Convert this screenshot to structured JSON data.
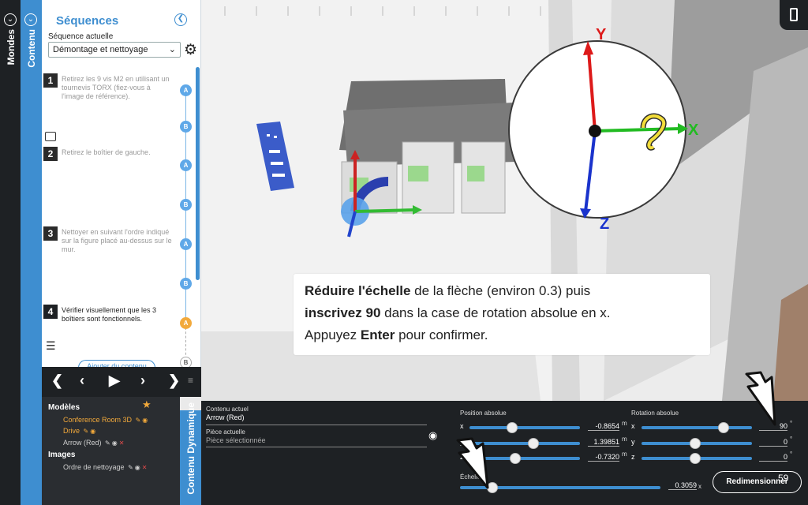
{
  "rail": {
    "mondes_label": "Mondes",
    "contenu_label": "Contenu"
  },
  "sequences": {
    "title": "Séquences",
    "current_label": "Séquence actuelle",
    "selected": "Démontage et nettoyage",
    "steps": [
      {
        "num": "1",
        "text": "Retirez les 9 vis M2 en utilisant un tournevis TORX (fiez-vous à l'image de référence).",
        "nodes": [
          "A",
          "B"
        ]
      },
      {
        "num": "2",
        "text": "Retirez le boîtier de gauche.",
        "nodes": [
          "A",
          "B"
        ]
      },
      {
        "num": "3",
        "text": "Nettoyer en suivant l'ordre indiqué sur la figure placé au-dessus sur le mur.",
        "nodes": [
          "A",
          "B"
        ]
      },
      {
        "num": "4",
        "text": "Vérifier visuellement que les 3 boîtiers sont fonctionnels.",
        "nodes": [
          "A",
          "B"
        ]
      }
    ],
    "add_button": "Ajouter du contenu"
  },
  "models": {
    "models_header": "Modèles",
    "items": [
      {
        "name": "Conference Room 3D",
        "highlight": true
      },
      {
        "name": "Drive",
        "highlight": true
      },
      {
        "name": "Arrow (Red)",
        "highlight": false
      }
    ],
    "images_header": "Images",
    "images": [
      {
        "name": "Ordre de nettoyage"
      }
    ],
    "dynamic_tab": "Contenu Dynamique"
  },
  "props": {
    "current_content_label": "Contenu actuel",
    "current_content": "Arrow (Red)",
    "current_part_label": "Pièce actuelle",
    "current_part_placeholder": "Pièce sélectionnée",
    "position_label": "Position absolue",
    "position": {
      "x": "-0.8654",
      "y": "1.39851",
      "z": "-0.7320",
      "unit": "m"
    },
    "rotation_label": "Rotation absolue",
    "rotation": {
      "x": "90",
      "y": "0",
      "z": "0",
      "unit": "°"
    },
    "scale_label": "Échelle",
    "scale": "0.3059",
    "scale_unit": "x",
    "resize_button": "Redimensionner",
    "fps": "59"
  },
  "instruction": {
    "p1_bold": "Réduire l'échelle",
    "p1_rest": " de la flèche (environ 0.3) puis",
    "p2_bold": "inscrivez 90",
    "p2_rest": " dans la case de rotation absolue en x.",
    "p3_a": "Appuyez ",
    "p3_bold": "Enter",
    "p3_rest": " pour confirmer."
  },
  "gizmo": {
    "y_label": "Y",
    "x_label": "X",
    "z_label": "Z"
  },
  "colors": {
    "accent": "#3e8ed0",
    "dark": "#1e2124",
    "orange": "#f2a93b"
  }
}
